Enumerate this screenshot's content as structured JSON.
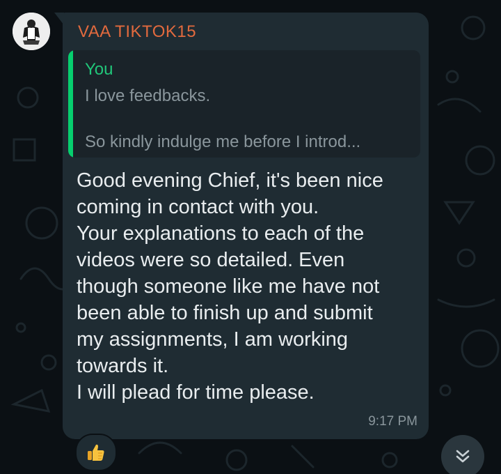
{
  "message": {
    "sender": "VAA TIKTOK15",
    "quoted": {
      "author": "You",
      "line1": "I love feedbacks.",
      "line2": "So kindly indulge me before I introd..."
    },
    "text": "Good evening Chief, it's been nice\ncoming in contact with you.\nYour explanations to each of the\nvideos were so detailed. Even\nthough someone like me have not\nbeen able to finish up and submit\nmy assignments, I am working\ntowards it.\nI will plead for time please.",
    "time": "9:17 PM",
    "reaction_icon": "thumbs-up-icon"
  },
  "colors": {
    "background": "#0b1014",
    "bubble": "#1f2c33",
    "sender_name": "#e26a3e",
    "quote_bar": "#06cf6e",
    "quote_author": "#21c77a",
    "text": "#e9edef",
    "meta": "#8a969c"
  },
  "scroll_button_icon": "double-chevron-down-icon"
}
